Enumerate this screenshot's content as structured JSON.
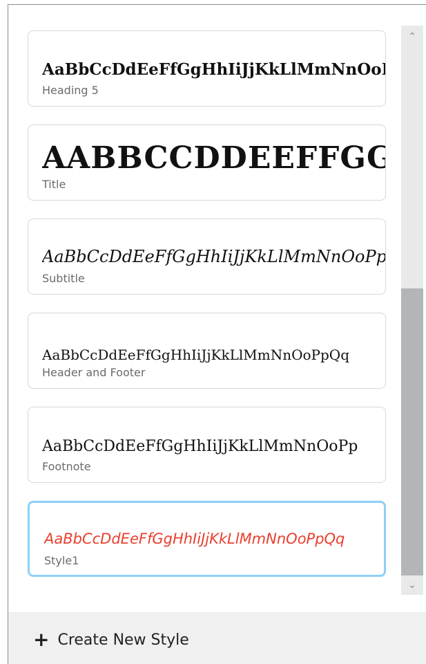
{
  "styles": [
    {
      "sample": "AaBbCcDdEeFfGgHhIiJjKkLlMmNnOoPp",
      "label": "Heading 5"
    },
    {
      "sample": "AABBCCDDEEFFGGHH",
      "label": "Title"
    },
    {
      "sample": "AaBbCcDdEeFfGgHhIiJjKkLlMmNnOoPp",
      "label": "Subtitle"
    },
    {
      "sample": "AaBbCcDdEeFfGgHhIiJjKkLlMmNnOoPpQq",
      "label": "Header and Footer"
    },
    {
      "sample": "AaBbCcDdEeFfGgHhIiJjKkLlMmNnOoPp",
      "label": "Footnote"
    },
    {
      "sample": "AaBbCcDdEeFfGgHhIiJjKkLlMmNnOoPpQq",
      "label": "Style1",
      "sample_color": "#e8402e",
      "selected": true
    }
  ],
  "footer": {
    "create_label": "Create New Style",
    "plus_icon": "+"
  },
  "scrollbar": {
    "up_icon": "⌃",
    "down_icon": "⌄",
    "position": 0.9
  },
  "colors": {
    "selected_border": "#8ed0f7",
    "style1_text": "#e8402e",
    "thumb": "#b3b5b8"
  }
}
